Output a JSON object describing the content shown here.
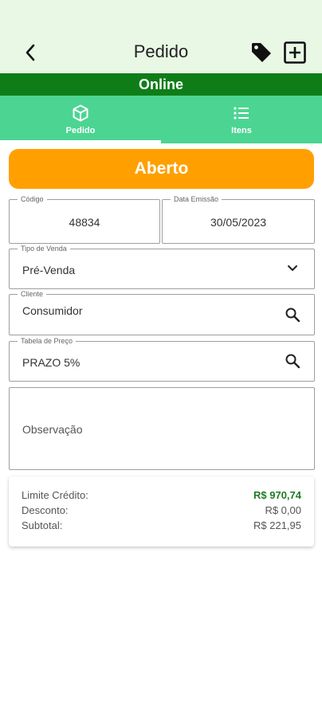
{
  "header": {
    "title": "Pedido"
  },
  "connection_status": "Online",
  "tabs": [
    {
      "label": "Pedido",
      "icon": "cube-icon",
      "active": true
    },
    {
      "label": "Itens",
      "icon": "list-icon",
      "active": false
    }
  ],
  "order_status": "Aberto",
  "form": {
    "codigo": {
      "label": "Código",
      "value": "48834"
    },
    "data_emissao": {
      "label": "Data Emissão",
      "value": "30/05/2023"
    },
    "tipo_venda": {
      "label": "Tipo de Venda",
      "value": "Pré-Venda"
    },
    "cliente": {
      "label": "Cliente",
      "value": "Consumidor"
    },
    "tabela_preco": {
      "label": "Tabela de Preço",
      "value": "PRAZO 5%"
    },
    "observacao": {
      "placeholder": "Observação"
    }
  },
  "summary": {
    "limite_credito": {
      "label": "Limite Crédito:",
      "value": "R$ 970,74"
    },
    "desconto": {
      "label": "Desconto:",
      "value": "R$ 0,00"
    },
    "subtotal": {
      "label": "Subtotal:",
      "value": "R$ 221,95"
    }
  },
  "colors": {
    "header_bg": "#e8f8e5",
    "status_bar": "#0e7d18",
    "tabs_bg": "#4cd493",
    "status_button": "#ffa000",
    "credit_green": "#1f7a25"
  }
}
